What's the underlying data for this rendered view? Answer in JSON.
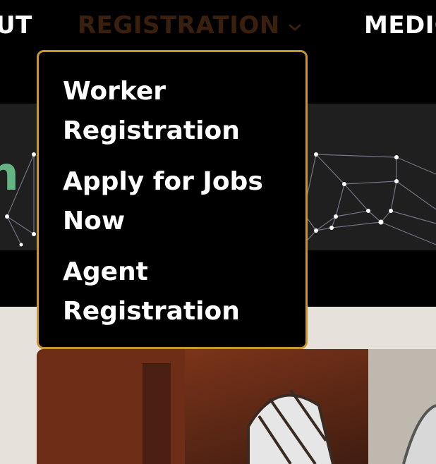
{
  "nav": {
    "about_fragment": "UT",
    "registration": "REGISTRATION",
    "medical_fragment": "MEDIC"
  },
  "dropdown": {
    "items": [
      {
        "label": "Worker Registration"
      },
      {
        "label": "Apply for Jobs Now"
      },
      {
        "label": "Agent Registration"
      }
    ]
  },
  "hero": {
    "heading_fragment": "n C"
  },
  "icons": {
    "registration_chevron": "chevron-down-icon"
  },
  "colors": {
    "dropdown_border": "#c9962a",
    "registration_text": "#3a200c",
    "hero_text": "#66b383",
    "content_bg": "#e6e1db"
  }
}
